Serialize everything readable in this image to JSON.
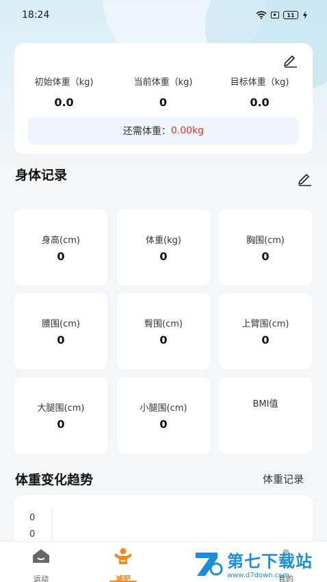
{
  "status_bar": {
    "time": "18:24",
    "battery": "11"
  },
  "weight_card": {
    "columns": [
      {
        "label": "初始体重（kg)",
        "value": "0.0"
      },
      {
        "label": "当前体重（kg)",
        "value": "0"
      },
      {
        "label": "目标体重（kg)",
        "value": "0.0"
      }
    ],
    "remaining_label": "还需体重：",
    "remaining_value": "0.00kg"
  },
  "body_record": {
    "title": "身体记录",
    "items": [
      {
        "label": "身高(cm)",
        "value": "0"
      },
      {
        "label": "体重(kg)",
        "value": "0"
      },
      {
        "label": "胸围(cm)",
        "value": "0"
      },
      {
        "label": "腰围(cm)",
        "value": "0"
      },
      {
        "label": "臀围(cm)",
        "value": "0"
      },
      {
        "label": "上臂围(cm)",
        "value": "0"
      },
      {
        "label": "大腿围(cm)",
        "value": "0"
      },
      {
        "label": "小腿围(cm)",
        "value": "0"
      },
      {
        "label": "BMI值",
        "value": ""
      }
    ]
  },
  "trend": {
    "title": "体重变化趋势",
    "link": "体重记录",
    "ticks": [
      "0",
      "0"
    ]
  },
  "tabbar": {
    "tabs": [
      {
        "label": "运动",
        "icon": "home-icon"
      },
      {
        "label": "减肥",
        "icon": "fitness-person-icon"
      },
      {
        "label": "我的",
        "icon": "profile-icon"
      }
    ]
  },
  "watermark": {
    "title": "第七下载站",
    "url": "www.d7down.com"
  },
  "colors": {
    "accent": "#f08a1c",
    "remaining": "#e0321f",
    "watermark": "#1a8fd8"
  }
}
